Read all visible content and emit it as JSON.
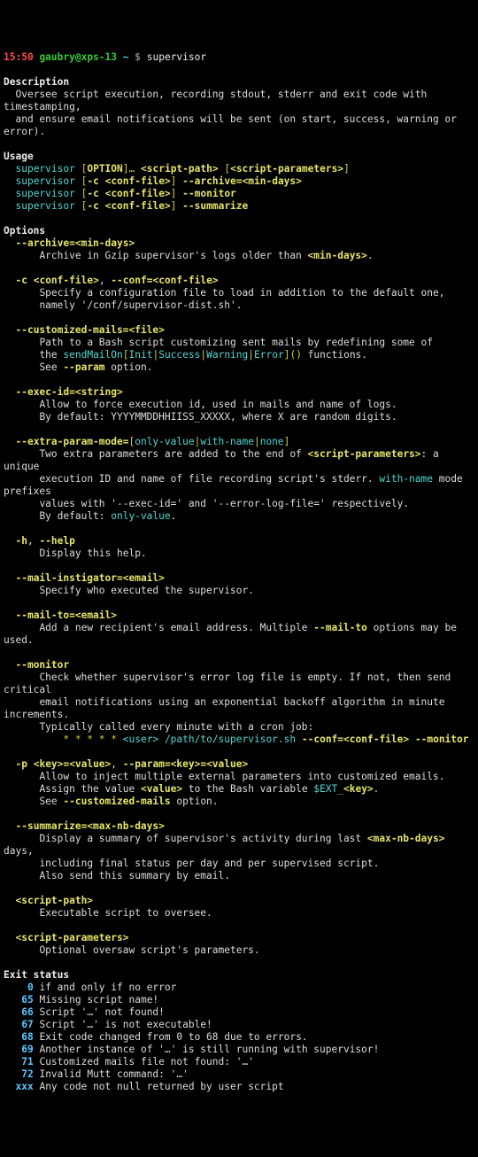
{
  "prompt": {
    "time": "15:50",
    "userhost": "gaubry@xps-13",
    "tilde": "~",
    "dollar": "$",
    "cmd": "supervisor"
  },
  "sec": {
    "description": "Description",
    "usage": "Usage",
    "options": "Options",
    "exit": "Exit status"
  },
  "desc": {
    "l1": "Oversee script execution, recording stdout, stderr and exit code with timestamping,",
    "l2": "and ensure email notifications will be sent (on start, success, warning or error)."
  },
  "usage": {
    "cmd": "supervisor",
    "lb": "[",
    "rb": "]",
    "option": "OPTION",
    "ellip": "…",
    "sp": "<script-path>",
    "spp": "<script-parameters>",
    "cflag": "-c",
    "cval": "<conf-file>",
    "archive": "--archive=",
    "mind": "<min-days>",
    "monitor": "--monitor",
    "summarize": "--summarize"
  },
  "opt": {
    "archive": {
      "name_a": "--archive=",
      "name_b": "<min-days>",
      "t1a": "Archive in Gzip supervisor's logs older than ",
      "t1b": "<min-days>",
      "t1c": "."
    },
    "conf": {
      "name_a": "-c",
      "name_b": "<conf-file>",
      "sep": ", ",
      "name_c": "--conf=",
      "name_d": "<conf-file>",
      "t1": "Specify a configuration file to load in addition to the default one,",
      "t2": "namely '/conf/supervisor-dist.sh'."
    },
    "cmails": {
      "name_a": "--customized-mails=",
      "name_b": "<file>",
      "t1": "Path to a Bash script customizing sent mails by redefining some of",
      "t2a": "the ",
      "fn": "sendMailOn",
      "br_l": "[",
      "br_r": "]",
      "pipe": "|",
      "m1": "Init",
      "m2": "Success",
      "m3": "Warning",
      "m4": "Error",
      "paren": "()",
      "t2b": " functions.",
      "t3a": "See ",
      "t3b": "--param",
      "t3c": " option."
    },
    "exec": {
      "name_a": "--exec-id=",
      "name_b": "<string>",
      "t1": "Allow to force execution id, used in mails and name of logs.",
      "t2": "By default: YYYYMMDDHHIISS_XXXXX, where X are random digits."
    },
    "extra": {
      "name_a": "--extra-param-mode=",
      "lb": "[",
      "rb": "]",
      "pipe": "|",
      "v1": "only-value",
      "v2": "with-name",
      "v3": "none",
      "t1a": "Two extra parameters are added to the end of ",
      "t1b": "<script-parameters>",
      "t1c": ": a unique",
      "t2a": "execution ID and name of file recording script's stderr. ",
      "t2b": "with-name",
      "t2c": " mode prefixes",
      "t3": "values with '--exec-id=' and '--error-log-file=' respectively.",
      "t4a": "By default: ",
      "t4b": "only-value",
      "t4c": "."
    },
    "help": {
      "name_a": "-h",
      "sep": ", ",
      "name_b": "--help",
      "t1": "Display this help."
    },
    "minst": {
      "name_a": "--mail-instigator=",
      "name_b": "<email>",
      "t1": "Specify who executed the supervisor."
    },
    "mailto": {
      "name_a": "--mail-to=",
      "name_b": "<email>",
      "t1a": "Add a new recipient's email address. Multiple ",
      "t1b": "--mail-to",
      "t1c": " options may be used."
    },
    "mon": {
      "name": "--monitor",
      "t1": "Check whether supervisor's error log file is empty. If not, then send critical",
      "t2": "email notifications using an exponential backoff algorithm in minute increments.",
      "t3": "Typically called every minute with a cron job:",
      "cron": "* * * * *",
      "user": "<user>",
      "path": "/path/to/supervisor.sh",
      "cflag": "--conf=",
      "cval": "<conf-file>",
      "mflag": "--monitor"
    },
    "param": {
      "name_a": "-p",
      "name_b": "<key>=<value>",
      "sep": ", ",
      "name_c": "--param=",
      "name_d": "<key>=<value>",
      "t1": "Allow to inject multiple external parameters into customized emails.",
      "t2a": "Assign the value ",
      "t2b": "<value>",
      "t2c": " to the Bash variable ",
      "var": "$EXT_",
      "key": "<key>",
      "t2d": ".",
      "t3a": "See ",
      "t3b": "--customized-mails",
      "t3c": " option."
    },
    "summ": {
      "name_a": "--summarize=",
      "name_b": "<max-nb-days>",
      "t1a": "Display a summary of supervisor's activity during last ",
      "t1b": "<max-nb-days>",
      "t1c": " days,",
      "t2": "including final status per day and per supervised script.",
      "t3": "Also send this summary by email."
    },
    "spath": {
      "name": "<script-path>",
      "t1": "Executable script to oversee."
    },
    "sparam": {
      "name": "<script-parameters>",
      "t1": "Optional oversaw script's parameters."
    }
  },
  "exit": {
    "c0": {
      "n": "0",
      "t": "if and only if no error"
    },
    "c65": {
      "n": "65",
      "t": "Missing script name!"
    },
    "c66": {
      "n": "66",
      "t": "Script '…' not found!"
    },
    "c67": {
      "n": "67",
      "t": "Script '…' is not executable!"
    },
    "c68": {
      "n": "68",
      "t": "Exit code changed from 0 to 68 due to errors."
    },
    "c69": {
      "n": "69",
      "t": "Another instance of '…' is still running with supervisor!"
    },
    "c71": {
      "n": "71",
      "t": "Customized mails file not found: '…'"
    },
    "c72": {
      "n": "72",
      "t": "Invalid Mutt command: '…'"
    },
    "cx": {
      "n": "xxx",
      "t": "Any code not null returned by user script"
    }
  },
  "tree": {
    "side": "  ",
    "side2": "    "
  }
}
